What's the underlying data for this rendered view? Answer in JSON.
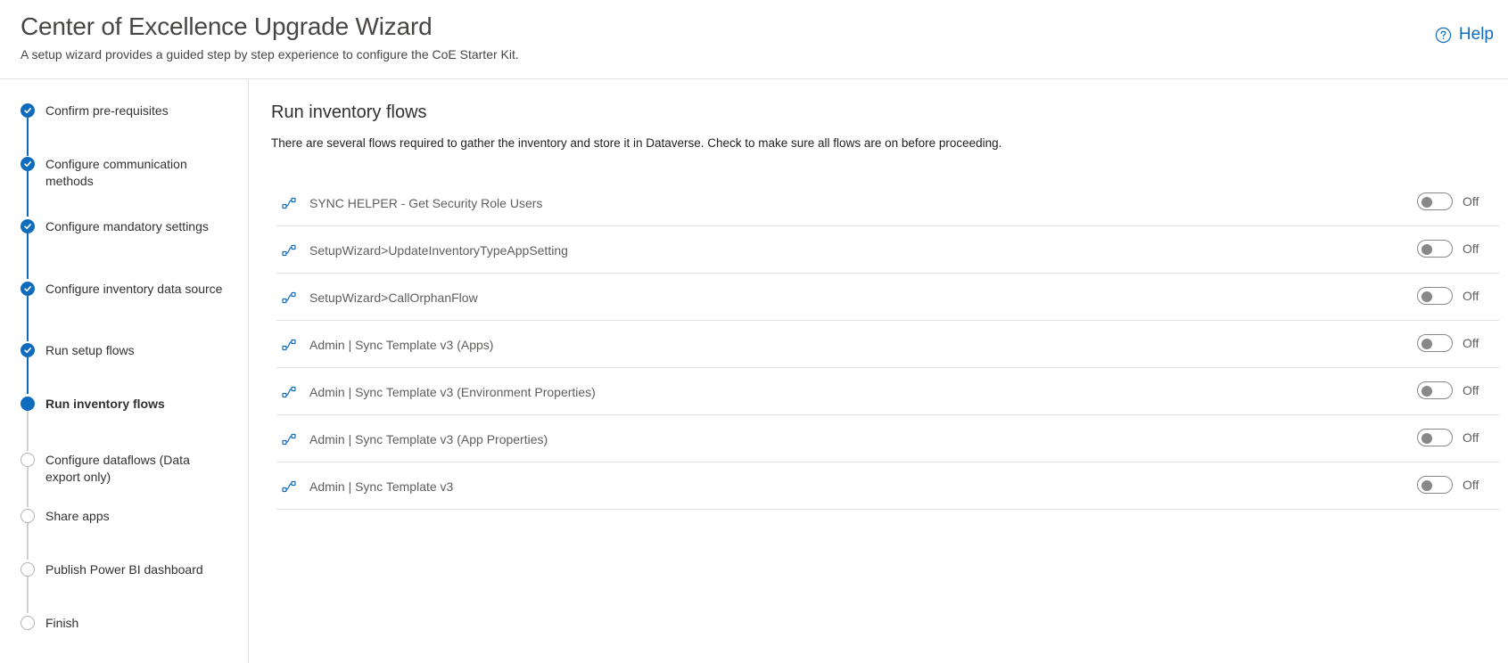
{
  "header": {
    "title": "Center of Excellence Upgrade Wizard",
    "subtitle": "A setup wizard provides a guided step by step experience to configure the CoE Starter Kit.",
    "help_label": "Help"
  },
  "colors": {
    "accent": "#0f6cbd",
    "pending": "#b3b0ad",
    "divider": "#e1dfdd"
  },
  "steps": [
    {
      "label": "Confirm pre-requisites",
      "status": "done"
    },
    {
      "label": "Configure communication methods",
      "status": "done"
    },
    {
      "label": "Configure mandatory settings",
      "status": "done"
    },
    {
      "label": "Configure inventory data source",
      "status": "done"
    },
    {
      "label": "Run setup flows",
      "status": "done"
    },
    {
      "label": "Run inventory flows",
      "status": "current"
    },
    {
      "label": "Configure dataflows (Data export only)",
      "status": "todo"
    },
    {
      "label": "Share apps",
      "status": "todo"
    },
    {
      "label": "Publish Power BI dashboard",
      "status": "todo"
    },
    {
      "label": "Finish",
      "status": "todo"
    }
  ],
  "main": {
    "title": "Run inventory flows",
    "description": "There are several flows required to gather the inventory and store it in Dataverse. Check to make sure all flows are on before proceeding.",
    "flows": [
      {
        "name": "SYNC HELPER - Get Security Role Users",
        "state": "Off",
        "icon": "flow-icon"
      },
      {
        "name": "SetupWizard>UpdateInventoryTypeAppSetting",
        "state": "Off",
        "icon": "flow-icon"
      },
      {
        "name": "SetupWizard>CallOrphanFlow",
        "state": "Off",
        "icon": "flow-icon"
      },
      {
        "name": "Admin | Sync Template v3 (Apps)",
        "state": "Off",
        "icon": "flow-icon"
      },
      {
        "name": "Admin | Sync Template v3 (Environment Properties)",
        "state": "Off",
        "icon": "flow-icon"
      },
      {
        "name": "Admin | Sync Template v3 (App Properties)",
        "state": "Off",
        "icon": "flow-icon"
      },
      {
        "name": "Admin | Sync Template v3",
        "state": "Off",
        "icon": "flow-icon"
      }
    ]
  }
}
